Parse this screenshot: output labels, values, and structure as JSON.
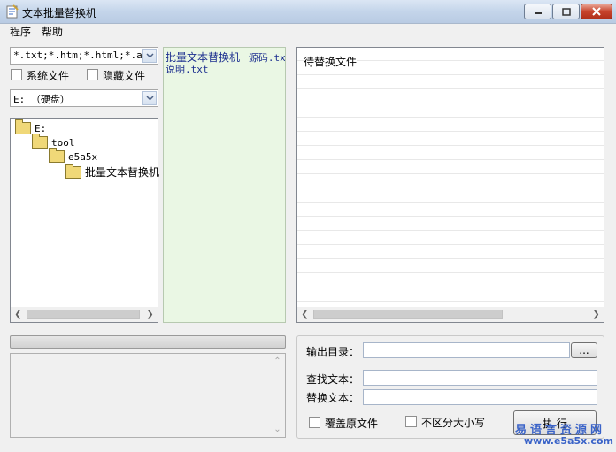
{
  "window": {
    "title": "文本批量替换机"
  },
  "menu": [
    "程序",
    "帮助"
  ],
  "filter": {
    "value": "*.txt;*.htm;*.html;*.asp"
  },
  "options": {
    "system_files": "系统文件",
    "hidden_files": "隐藏文件"
  },
  "drive": {
    "value": "E: （硬盘）"
  },
  "tree": [
    "E:",
    "tool",
    "e5a5x",
    "批量文本替换机"
  ],
  "files": {
    "line1a": "批量文本替换机",
    "line1b": "源码.txt",
    "line2": "说明.txt"
  },
  "pending": {
    "header": "待替换文件"
  },
  "form": {
    "output_label": "输出目录：",
    "browse_label": "...",
    "find_label": "查找文本：",
    "replace_label": "替换文本：",
    "overwrite_label": "覆盖原文件",
    "ignore_case_label": "不区分大小写",
    "execute_label": "执 行"
  },
  "watermark": {
    "top": "易语言资源网",
    "url": "www.e5a5x.com"
  }
}
